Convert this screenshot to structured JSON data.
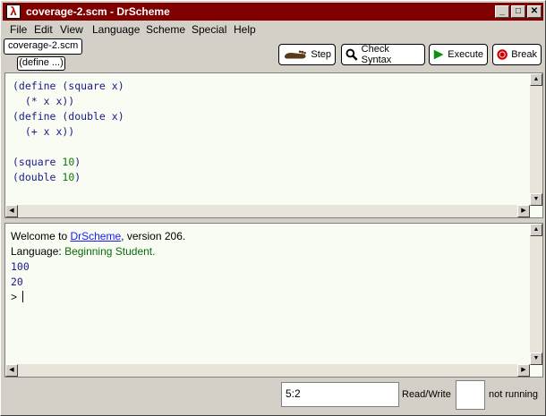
{
  "window": {
    "title": "coverage-2.scm - DrScheme",
    "icon": "lambda-icon",
    "controls": {
      "minimize": "_",
      "maximize": "□",
      "close": "✕"
    }
  },
  "menu": [
    "File",
    "Edit",
    "View",
    "Language",
    "Scheme",
    "Special",
    "Help"
  ],
  "file_tab": "coverage-2.scm",
  "define_menu": "(define ...)",
  "toolbar": {
    "step": "Step",
    "check_syntax": "Check Syntax",
    "execute": "Execute",
    "break": "Break"
  },
  "editor": {
    "lines": [
      "(define (square x)",
      "  (* x x))",
      "(define (double x)",
      "  (+ x x))",
      "",
      "(square 10)",
      "(double 10)"
    ]
  },
  "repl": {
    "welcome_prefix": "Welcome to ",
    "welcome_link": "DrScheme",
    "welcome_suffix": ", version 206.",
    "language_label": "Language: ",
    "language_value": "Beginning Student.",
    "outputs": [
      "100",
      "20"
    ],
    "prompt": ">"
  },
  "status": {
    "position": "5:2",
    "mode": "Read/Write",
    "running": "not running"
  },
  "colors": {
    "title_bar": "#800000",
    "keyword": "#1a1a8c",
    "number": "#0a7a0a",
    "link": "#1a1aff",
    "editor_bg": "#f8fcf2"
  }
}
